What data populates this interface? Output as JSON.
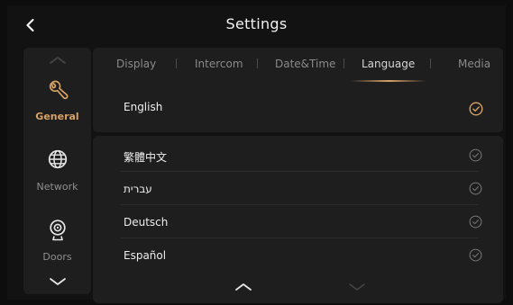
{
  "header": {
    "title": "Settings",
    "back_icon": "chevron-left-icon"
  },
  "sidebar": {
    "items": [
      {
        "label": "General",
        "icon": "wrench-icon",
        "active": true
      },
      {
        "label": "Network",
        "icon": "globe-icon",
        "active": false
      },
      {
        "label": "Doors",
        "icon": "doorbell-camera-icon",
        "active": false
      }
    ]
  },
  "tabs": [
    {
      "label": "Display"
    },
    {
      "label": "Intercom"
    },
    {
      "label": "Date&Time"
    },
    {
      "label": "Language",
      "active": true
    },
    {
      "label": "Media"
    }
  ],
  "current_language": {
    "label": "English",
    "selected": true
  },
  "languages": [
    {
      "label": "繁體中文"
    },
    {
      "label": "עברית"
    },
    {
      "label": "Deutsch"
    },
    {
      "label": "Español"
    }
  ],
  "colors": {
    "accent": "#d7a266",
    "panel": "#1e1e1e",
    "background": "#0d0d0d",
    "muted_check": "#6f6f6f"
  }
}
